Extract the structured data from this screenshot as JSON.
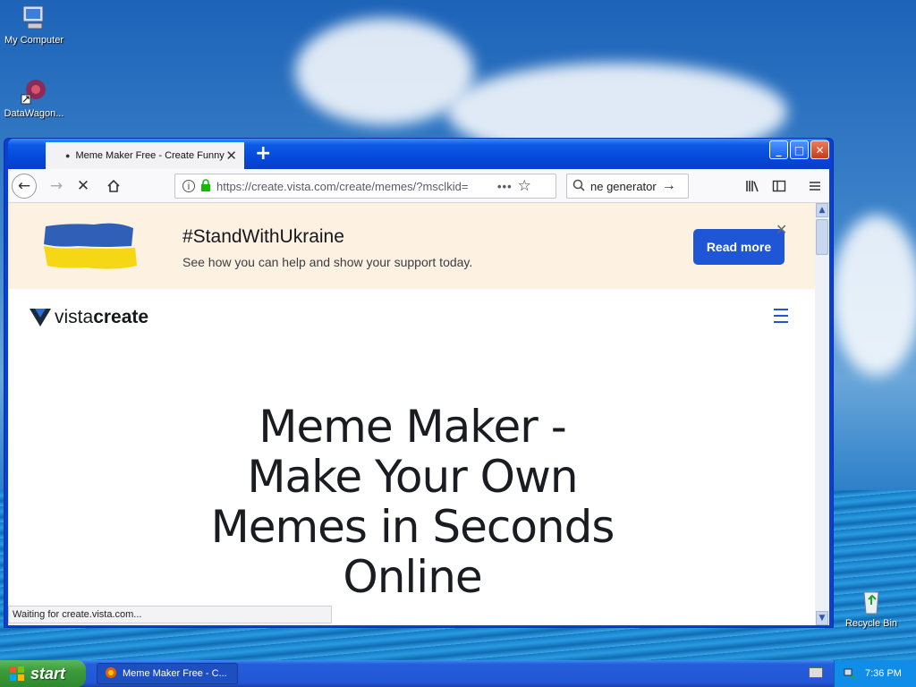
{
  "desktop": {
    "icons": [
      {
        "label": "My Computer",
        "icon": "my-computer-icon"
      },
      {
        "label": "DataWagon...",
        "icon": "datawagon-shortcut-icon"
      },
      {
        "label": "Recycle Bin",
        "icon": "recycle-bin-icon"
      }
    ]
  },
  "browser": {
    "tab_title": "Meme Maker Free - Create Funny",
    "url": "https://create.vista.com/create/memes/?msclkid=",
    "search_text": "ne generator",
    "status": "Waiting for create.vista.com..."
  },
  "page": {
    "banner_title": "#StandWithUkraine",
    "banner_text": "See how you can help and show your support today.",
    "banner_button": "Read more",
    "logo_light": "vista",
    "logo_bold": "create",
    "hero_lines": [
      "Meme Maker -",
      "Make Your Own",
      "Memes in Seconds",
      "Online"
    ]
  },
  "taskbar": {
    "start_label": "start",
    "task_label": "Meme Maker Free - C...",
    "clock": "7:36 PM"
  },
  "colors": {
    "accent": "#1f56d6",
    "banner_bg": "#fdf1e2",
    "flag_blue": "#2f5fb7",
    "flag_yellow": "#f5d716"
  }
}
